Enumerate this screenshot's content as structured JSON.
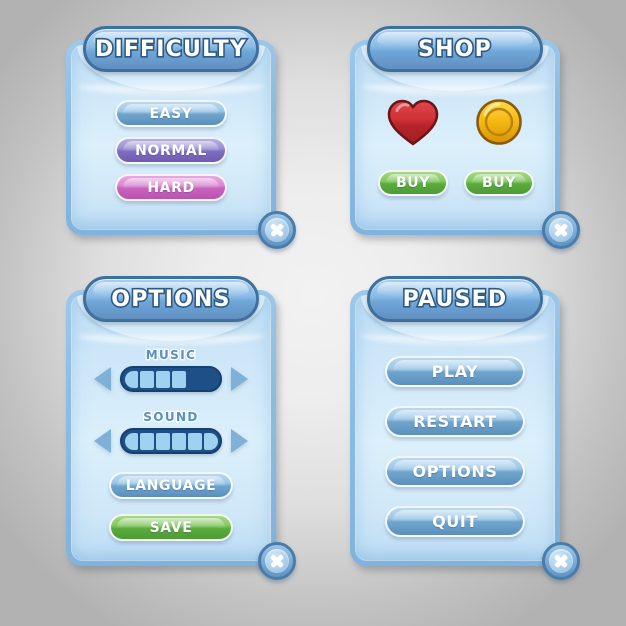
{
  "theme": {
    "background_center": "#f2f2f2",
    "background_edge": "#b2b2b2",
    "panel_frame": "#8cbde4",
    "panel_body": "#d6ecfa",
    "title_pill": "#8dbde7",
    "title_outline": "#2e597f",
    "button_blue": "#6fa5cd",
    "button_purple": "#7f6cc0",
    "button_pink": "#c863bd",
    "button_green": "#5aab3e",
    "close_button": "#7fb0da",
    "slider_track": "#1f4f87",
    "slider_fill": "#9fd2ee",
    "heart_color": "#c0262b",
    "coin_color": "#f2b705"
  },
  "panels": [
    {
      "id": "difficulty",
      "title": "DIFFICULTY",
      "close_label": "close",
      "buttons": [
        {
          "label": "EASY",
          "style": "blue"
        },
        {
          "label": "NORMAL",
          "style": "purple"
        },
        {
          "label": "HARD",
          "style": "pink"
        }
      ]
    },
    {
      "id": "shop",
      "title": "SHOP",
      "close_label": "close",
      "items": [
        {
          "icon": "heart-icon",
          "buy_label": "BUY"
        },
        {
          "icon": "coin-icon",
          "buy_label": "BUY"
        }
      ]
    },
    {
      "id": "options",
      "title": "OPTIONS",
      "close_label": "close",
      "sliders": [
        {
          "label": "MUSIC",
          "segments": 6,
          "filled": 4,
          "value_percent": 67
        },
        {
          "label": "SOUND",
          "segments": 6,
          "filled": 6,
          "value_percent": 100
        }
      ],
      "buttons": [
        {
          "label": "LANGUAGE",
          "style": "blue"
        },
        {
          "label": "SAVE",
          "style": "green"
        }
      ]
    },
    {
      "id": "paused",
      "title": "PAUSED",
      "close_label": "close",
      "buttons": [
        {
          "label": "PLAY",
          "style": "blue"
        },
        {
          "label": "RESTART",
          "style": "blue"
        },
        {
          "label": "OPTIONS",
          "style": "blue"
        },
        {
          "label": "QUIT",
          "style": "blue"
        }
      ]
    }
  ]
}
